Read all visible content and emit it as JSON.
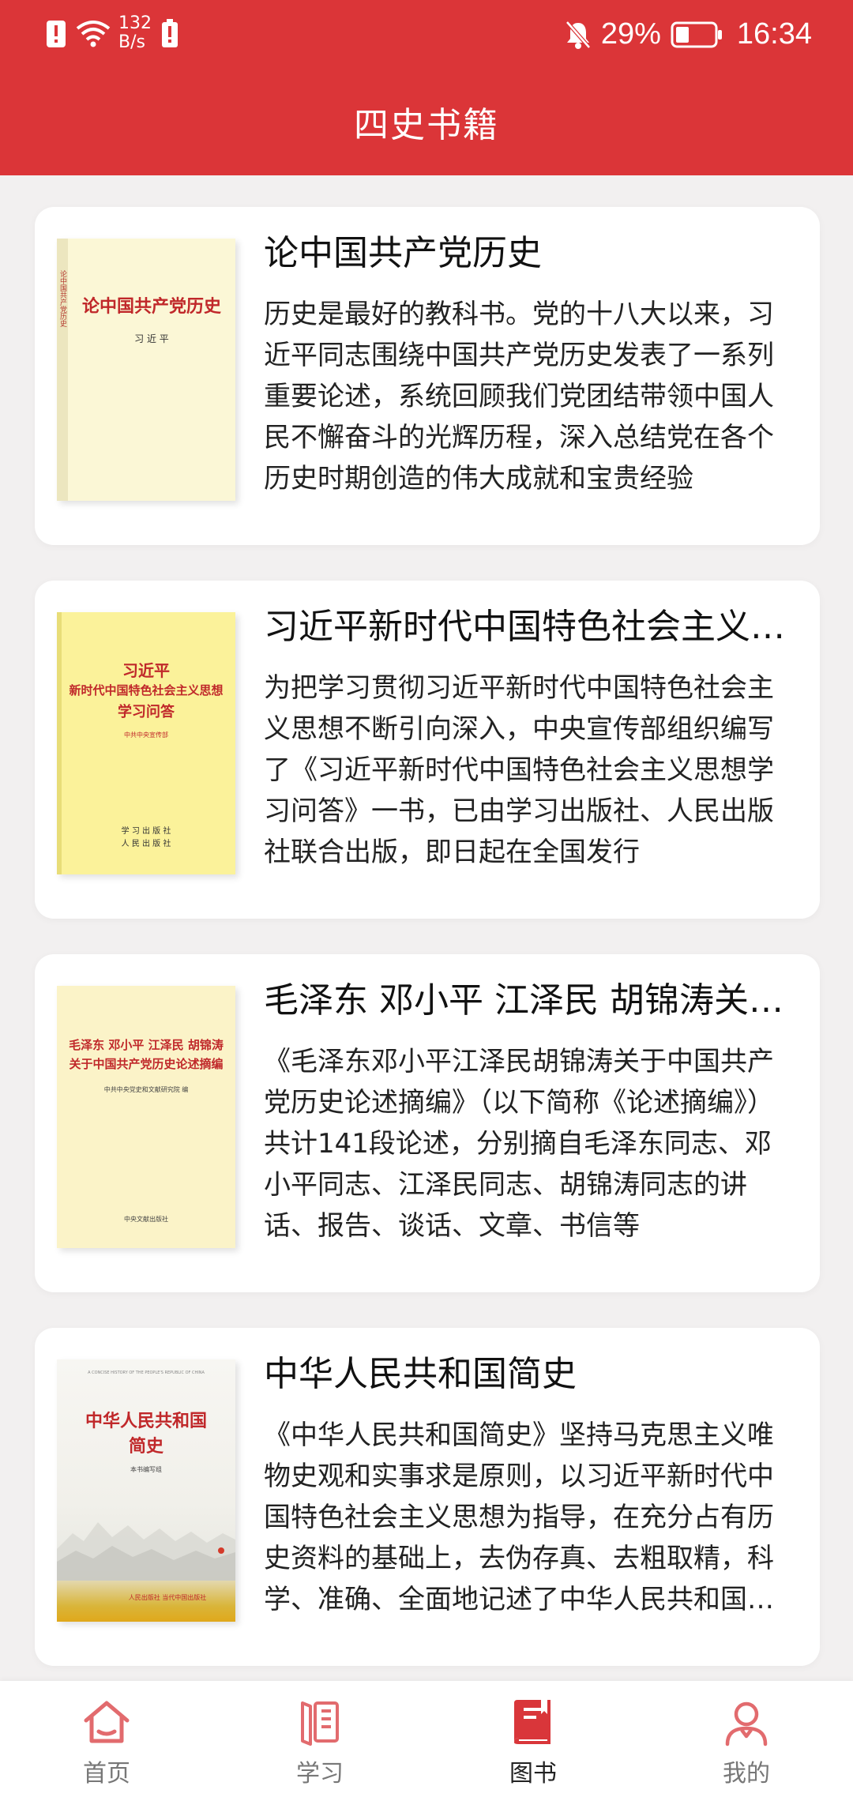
{
  "status_bar": {
    "net_speed_value": "132",
    "net_speed_unit": "B/s",
    "battery_percent": "29%",
    "time": "16:34"
  },
  "header": {
    "title": "四史书籍"
  },
  "books": [
    {
      "title": "论中国共产党历史",
      "description": "历史是最好的教科书。党的十八大以来，习近平同志围绕中国共产党历史发表了一系列重要论述，系统回顾我们党团结带领中国人民不懈奋斗的光辉历程，深入总结党在各个历史时期创造的伟大成就和宝贵经验",
      "cover": {
        "title": "论中国共产党历史",
        "author": "习 近 平",
        "spine": "论中国共产党历史"
      }
    },
    {
      "title": "习近平新时代中国特色社会主义思想学习问答",
      "description": "为把学习贯彻习近平新时代中国特色社会主义思想不断引向深入，中央宣传部组织编写了《习近平新时代中国特色社会主义思想学习问答》一书，已由学习出版社、人民出版社联合出版，即日起在全国发行",
      "cover": {
        "line1": "习近平",
        "line2": "新时代中国特色社会主义思想",
        "line3": "学习问答",
        "editor": "中共中央宣传部",
        "publisher1": "学 习 出 版 社",
        "publisher2": "人 民 出 版 社"
      }
    },
    {
      "title": "毛泽东 邓小平 江泽民 胡锦涛关于中国共产党历史论述摘编",
      "description": "《毛泽东邓小平江泽民胡锦涛关于中国共产党历史论述摘编》（以下简称《论述摘编》）共计141段论述，分别摘自毛泽东同志、邓小平同志、江泽民同志、胡锦涛同志的讲话、报告、谈话、文章、书信等",
      "cover": {
        "line1": "毛泽东 邓小平 江泽民 胡锦涛",
        "line2": "关于中国共产党历史论述摘编",
        "editor": "中共中央党史和文献研究院 编",
        "publisher": "中央文献出版社"
      }
    },
    {
      "title": "中华人民共和国简史",
      "description": "《中华人民共和国简史》坚持马克思主义唯物史观和实事求是原则，以习近平新时代中国特色社会主义思想为指导，在充分占有历史资料的基础上，去伪存真、去粗取精，科学、准确、全面地记述了中华人民共和国的历史",
      "cover": {
        "en": "A CONCISE HISTORY OF THE PEOPLE'S REPUBLIC OF CHINA",
        "line1": "中华人民共和国",
        "line2": "简史",
        "editor": "本书编写组",
        "publisher": "人民出版社 当代中国出版社"
      }
    }
  ],
  "bottom_nav": [
    {
      "label": "首页",
      "icon": "home-icon",
      "active": false
    },
    {
      "label": "学习",
      "icon": "study-icon",
      "active": false
    },
    {
      "label": "图书",
      "icon": "book-icon",
      "active": true
    },
    {
      "label": "我的",
      "icon": "profile-icon",
      "active": false
    }
  ],
  "colors": {
    "brand_red": "#db3538",
    "nav_active": "#d9363a",
    "nav_inactive": "#e26b6e"
  }
}
